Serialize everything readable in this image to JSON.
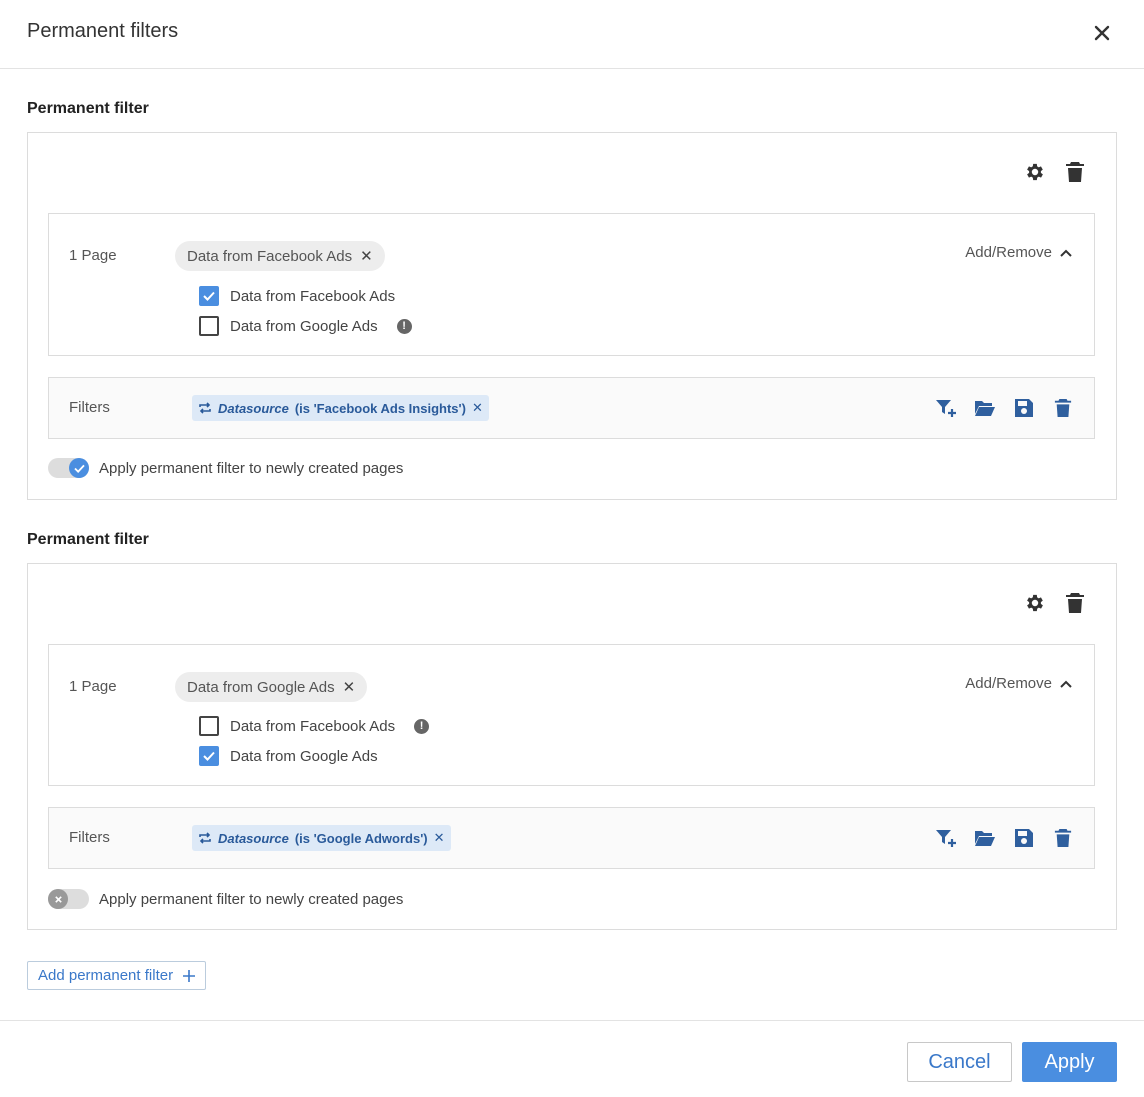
{
  "dialog": {
    "title": "Permanent filters"
  },
  "filters": [
    {
      "section_title": "Permanent filter",
      "page_count_label": "1 Page",
      "selected_chip": "Data from Facebook Ads",
      "add_remove_label": "Add/Remove",
      "options": [
        {
          "label": "Data from Facebook Ads",
          "checked": true,
          "warning": false
        },
        {
          "label": "Data from Google Ads",
          "checked": false,
          "warning": true
        }
      ],
      "filters_label": "Filters",
      "filter_tag": {
        "field": "Datasource",
        "condition": "(is 'Facebook Ads Insights')"
      },
      "toggle_label": "Apply permanent filter to newly created pages",
      "toggle_on": true
    },
    {
      "section_title": "Permanent filter",
      "page_count_label": "1 Page",
      "selected_chip": "Data from Google Ads",
      "add_remove_label": "Add/Remove",
      "options": [
        {
          "label": "Data from Facebook Ads",
          "checked": false,
          "warning": true
        },
        {
          "label": "Data from Google Ads",
          "checked": true,
          "warning": false
        }
      ],
      "filters_label": "Filters",
      "filter_tag": {
        "field": "Datasource",
        "condition": "(is 'Google Adwords')"
      },
      "toggle_label": "Apply permanent filter to newly created pages",
      "toggle_on": false
    }
  ],
  "add_filter_label": "Add permanent filter",
  "footer": {
    "cancel_label": "Cancel",
    "apply_label": "Apply"
  },
  "colors": {
    "accent": "#4a8ee0",
    "link": "#3a78c9",
    "tag_bg": "#dde9f7",
    "icon_blue": "#2f5f9e"
  }
}
